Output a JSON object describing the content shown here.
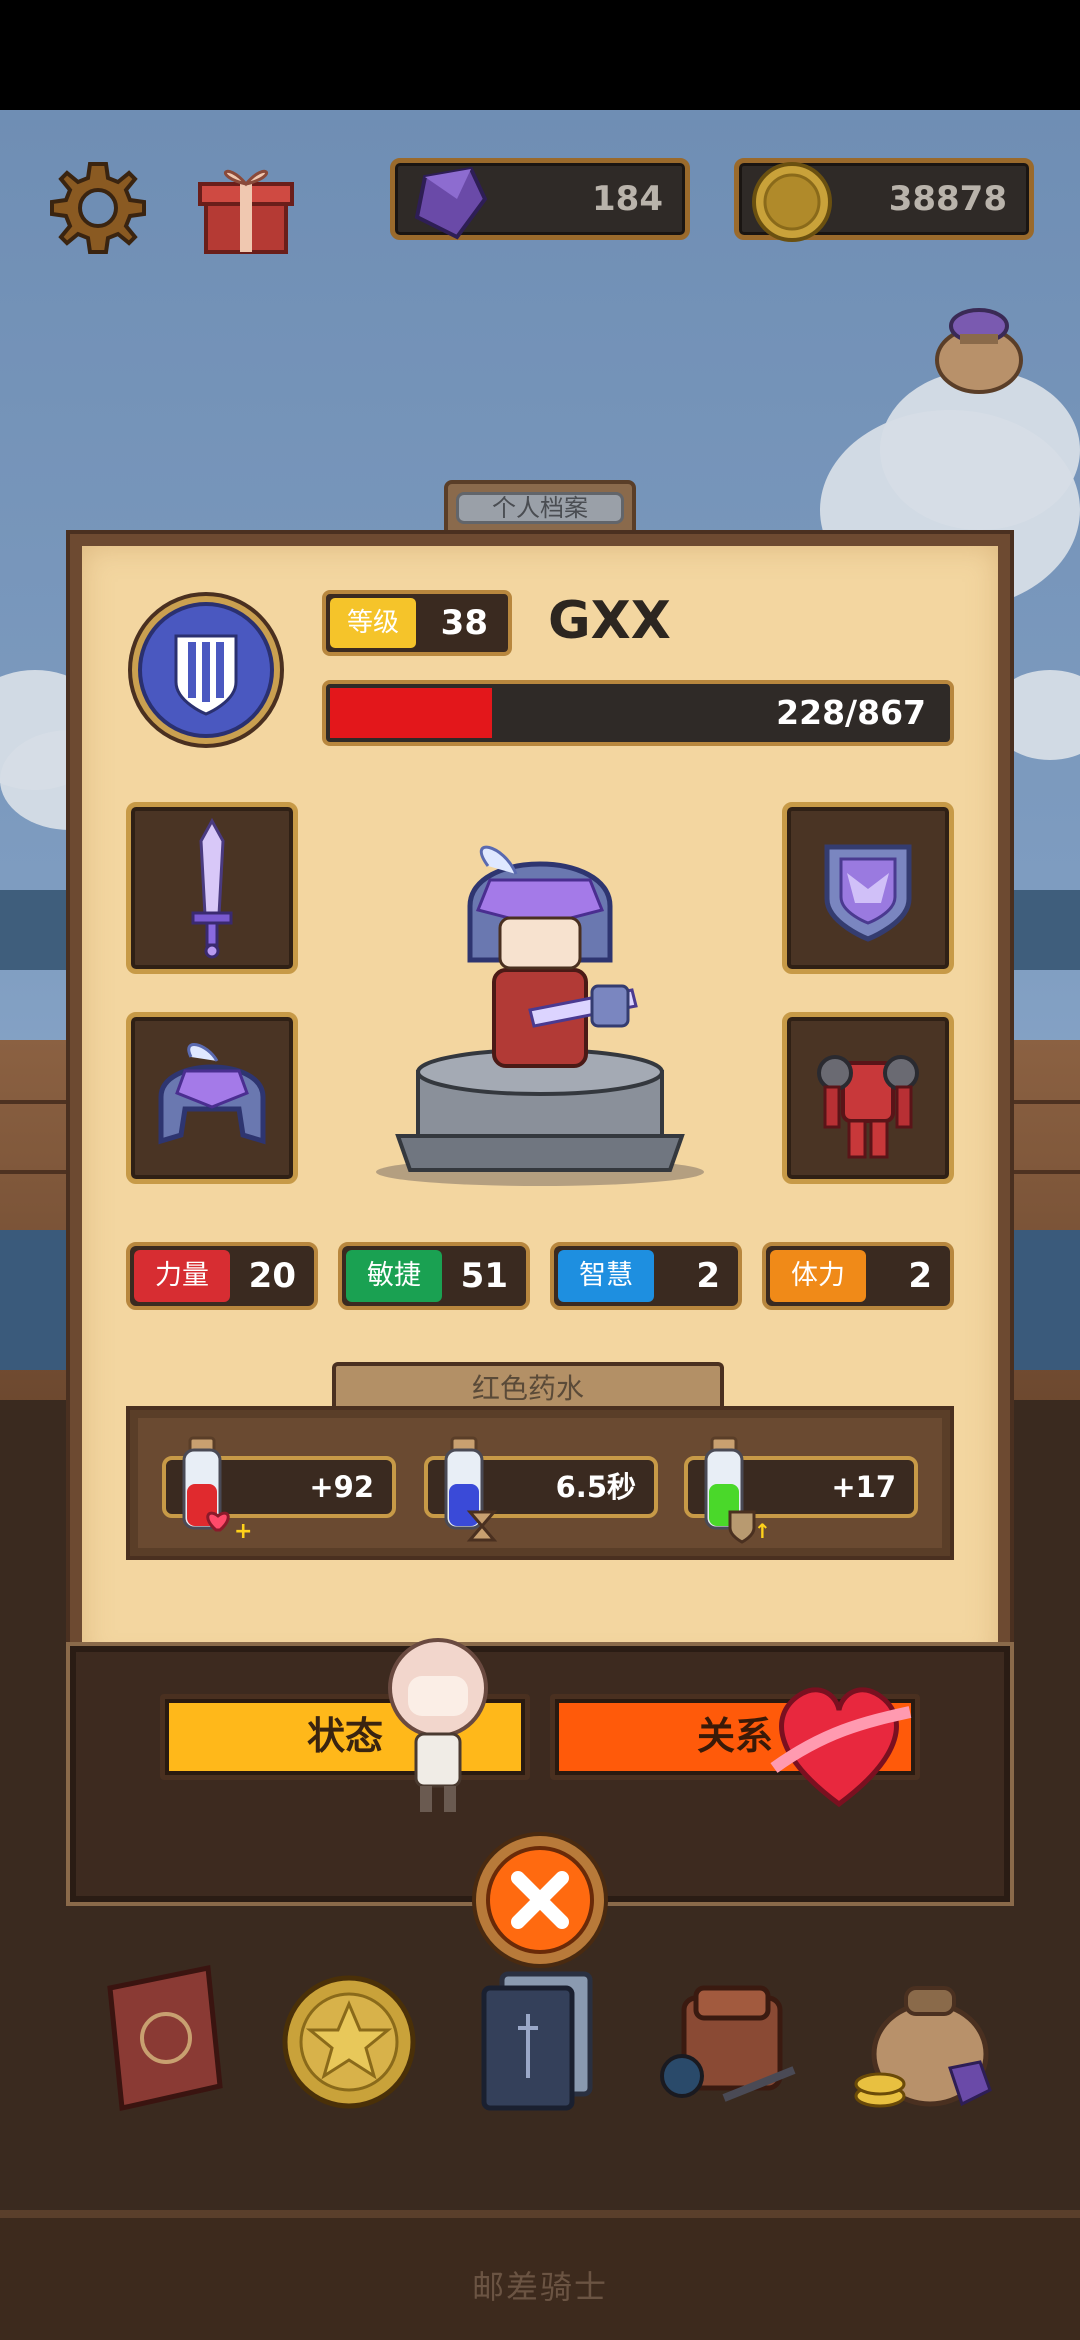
{
  "hud": {
    "settings_icon": "gear-icon",
    "gift_icon": "gift-icon",
    "gems": "184",
    "coins": "38878",
    "bag_icon": "gem-bag-icon"
  },
  "profile": {
    "tab_title": "个人档案",
    "level_label": "等级",
    "level_value": "38",
    "name": "GXX",
    "hp_text": "228/867",
    "hp_fraction": 0.263,
    "hp_color": "#e3171b"
  },
  "equipment": {
    "weapon": "crystal-sword-icon",
    "shield": "crystal-shield-icon",
    "helmet": "crystal-helmet-icon",
    "armor": "red-armor-icon"
  },
  "stats": [
    {
      "label": "力量",
      "value": "20",
      "color": "#d72d32"
    },
    {
      "label": "敏捷",
      "value": "51",
      "color": "#1aa152"
    },
    {
      "label": "智慧",
      "value": "2",
      "color": "#1e8fe0"
    },
    {
      "label": "体力",
      "value": "2",
      "color": "#f08a18"
    }
  ],
  "potion_section": {
    "title": "红色药水",
    "items": [
      {
        "value": "+92",
        "icon": "red-potion-heart-icon"
      },
      {
        "value": "6.5秒",
        "icon": "blue-potion-hourglass-icon"
      },
      {
        "value": "+17",
        "icon": "green-potion-shield-icon"
      }
    ]
  },
  "actions": {
    "status_label": "状态",
    "relation_label": "关系",
    "close_icon": "close-icon"
  },
  "nav": [
    {
      "icon": "book-icon"
    },
    {
      "icon": "star-coin-icon"
    },
    {
      "icon": "cards-icon"
    },
    {
      "icon": "backpack-icon"
    },
    {
      "icon": "treasure-bag-icon"
    }
  ],
  "footer": {
    "title": "邮差骑士"
  }
}
